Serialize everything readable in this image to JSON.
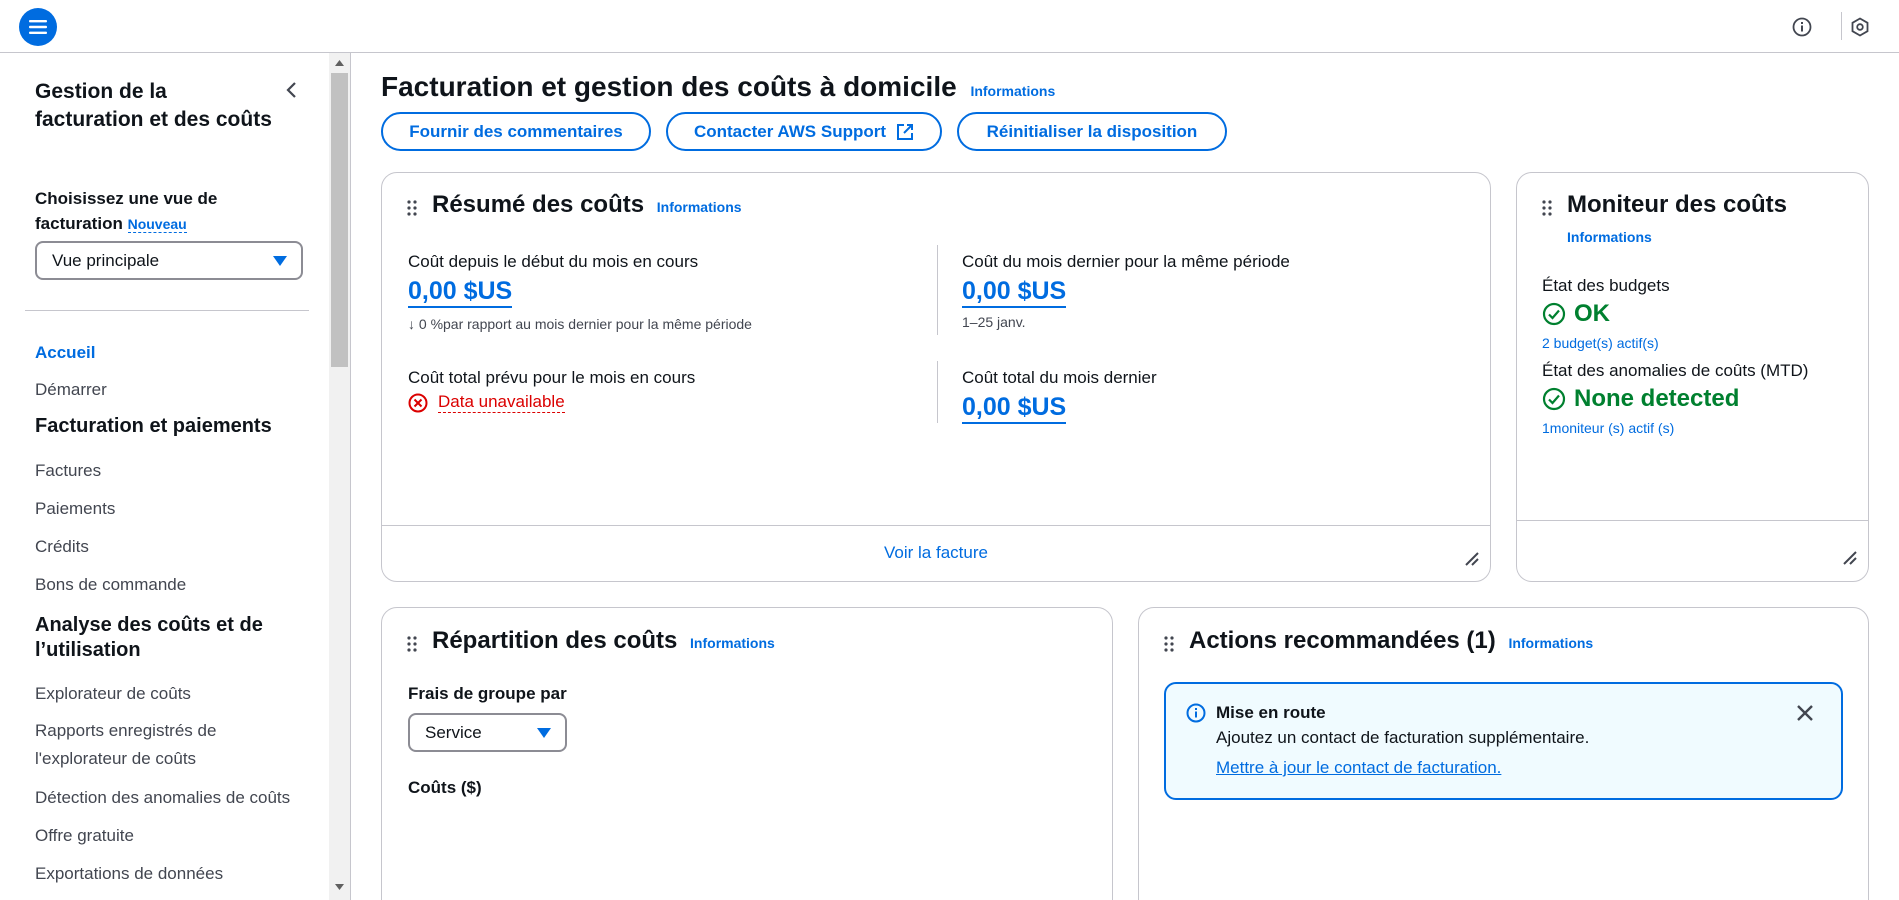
{
  "header": {
    "menu_icon": "hamburger-menu-icon",
    "info_icon": "info-circle-icon",
    "settings_icon": "hexagon-settings-icon"
  },
  "sidebar": {
    "title": "Gestion de la facturation et des coûts",
    "view_label": "Choisissez une vue de facturation",
    "view_new": "Nouveau",
    "view_select": "Vue principale",
    "home": "Accueil",
    "start": "Démarrer",
    "section_billing": "Facturation et paiements",
    "billing_items": [
      "Factures",
      "Paiements",
      "Crédits",
      "Bons de commande"
    ],
    "section_analysis": "Analyse des coûts et de l’utilisation",
    "analysis_items": [
      "Explorateur de coûts",
      "Rapports enregistrés de l'explorateur de coûts",
      "Détection des anomalies de coûts",
      "Offre gratuite",
      "Exportations de données"
    ]
  },
  "main": {
    "title": "Facturation et gestion des coûts à domicile",
    "info": "Informations",
    "buttons": {
      "feedback": "Fournir des commentaires",
      "support": "Contacter AWS Support",
      "reset": "Réinitialiser la disposition"
    }
  },
  "summary": {
    "title": "Résumé des coûts",
    "info": "Informations",
    "mtd_label": "Coût depuis le début du mois en cours",
    "mtd_value": "0,00 $US",
    "mtd_change": "0 %par rapport au mois dernier pour la même période",
    "last_same_label": "Coût du mois dernier pour la même période",
    "last_same_value": "0,00 $US",
    "last_same_range": "1–25 janv.",
    "forecast_label": "Coût total prévu pour le mois en cours",
    "forecast_value": "Data unavailable",
    "last_total_label": "Coût total du mois dernier",
    "last_total_value": "0,00 $US",
    "footer_link": "Voir la facture"
  },
  "monitor": {
    "title": "Moniteur des coûts",
    "info": "Informations",
    "budget_label": "État des budgets",
    "budget_status": "OK",
    "budget_link": "2 budget(s) actif(s)",
    "anomaly_label": "État des anomalies de coûts (MTD)",
    "anomaly_status": "None detected",
    "anomaly_link": "1moniteur (s) actif (s)"
  },
  "breakdown": {
    "title": "Répartition des coûts",
    "info": "Informations",
    "group_label": "Frais de groupe par",
    "group_select": "Service",
    "costs_label": "Coûts ($)"
  },
  "actions": {
    "title": "Actions recommandées (1)",
    "info": "Informations",
    "alert_title": "Mise en route",
    "alert_text": "Ajoutez un contact de facturation supplémentaire.",
    "alert_link": "Mettre à jour le contact de facturation."
  },
  "colors": {
    "accent": "#006ce0",
    "success": "#00802f",
    "error": "#db0000"
  }
}
